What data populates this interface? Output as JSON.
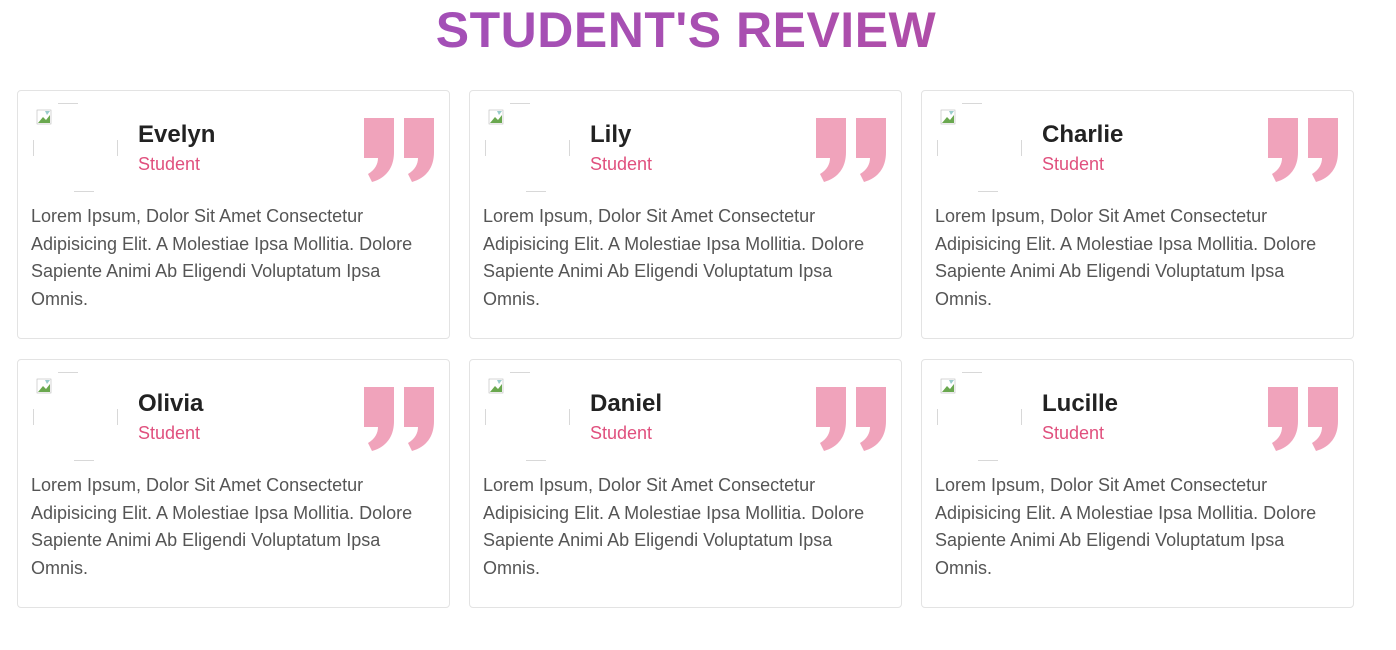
{
  "section": {
    "title": "STUDENT'S REVIEW"
  },
  "colors": {
    "title_gradient_start": "#9b4fc0",
    "title_gradient_end": "#c04a96",
    "role_text": "#e0507e",
    "quote_icon": "#f0a3bb"
  },
  "reviews": [
    {
      "name": "Evelyn",
      "role": "Student",
      "text": "Lorem Ipsum, Dolor Sit Amet Consectetur Adipisicing Elit. A Molestiae Ipsa Mollitia. Dolore Sapiente Animi Ab Eligendi Voluptatum Ipsa Omnis.",
      "icon": "broken-image-icon"
    },
    {
      "name": "Lily",
      "role": "Student",
      "text": "Lorem Ipsum, Dolor Sit Amet Consectetur Adipisicing Elit. A Molestiae Ipsa Mollitia. Dolore Sapiente Animi Ab Eligendi Voluptatum Ipsa Omnis.",
      "icon": "broken-image-icon"
    },
    {
      "name": "Charlie",
      "role": "Student",
      "text": "Lorem Ipsum, Dolor Sit Amet Consectetur Adipisicing Elit. A Molestiae Ipsa Mollitia. Dolore Sapiente Animi Ab Eligendi Voluptatum Ipsa Omnis.",
      "icon": "broken-image-icon"
    },
    {
      "name": "Olivia",
      "role": "Student",
      "text": "Lorem Ipsum, Dolor Sit Amet Consectetur Adipisicing Elit. A Molestiae Ipsa Mollitia. Dolore Sapiente Animi Ab Eligendi Voluptatum Ipsa Omnis.",
      "icon": "broken-image-icon"
    },
    {
      "name": "Daniel",
      "role": "Student",
      "text": "Lorem Ipsum, Dolor Sit Amet Consectetur Adipisicing Elit. A Molestiae Ipsa Mollitia. Dolore Sapiente Animi Ab Eligendi Voluptatum Ipsa Omnis.",
      "icon": "broken-image-icon"
    },
    {
      "name": "Lucille",
      "role": "Student",
      "text": "Lorem Ipsum, Dolor Sit Amet Consectetur Adipisicing Elit. A Molestiae Ipsa Mollitia. Dolore Sapiente Animi Ab Eligendi Voluptatum Ipsa Omnis.",
      "icon": "broken-image-icon"
    }
  ]
}
